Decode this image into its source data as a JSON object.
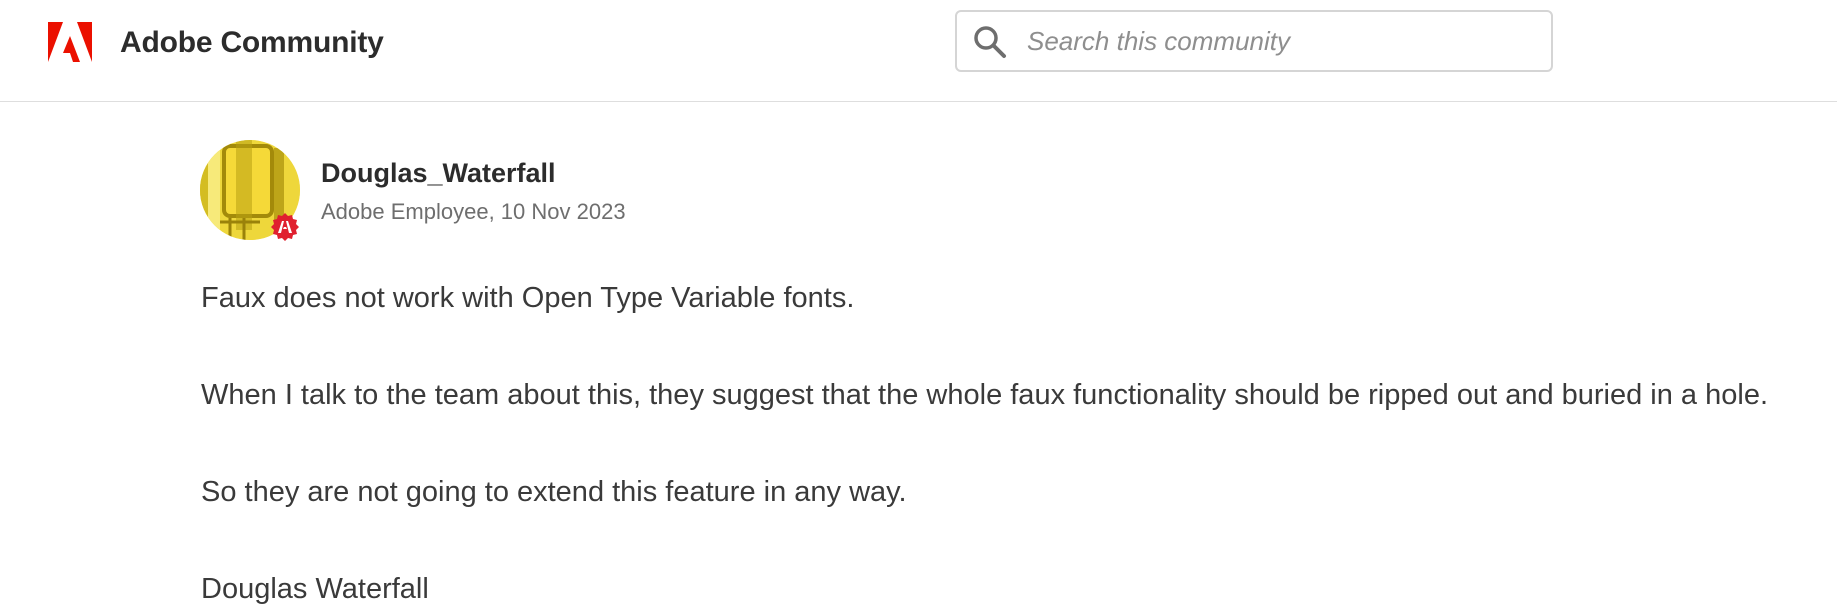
{
  "header": {
    "brand": "Adobe Community",
    "logo_icon": "adobe-logo-icon",
    "brand_color": "#eb1000",
    "search": {
      "placeholder": "Search this community",
      "value": ""
    }
  },
  "post": {
    "author": {
      "name": "Douglas_Waterfall",
      "role": "Adobe Employee",
      "date": "10 Nov 2023",
      "badge_icon": "adobe-employee-badge-icon"
    },
    "paragraphs": [
      "Faux does not work with Open Type Variable fonts.",
      "When I talk to the team about this, they suggest that the whole faux functionality should be ripped out and buried in a hole.",
      "So they are not going to extend this feature in any way.",
      "Douglas Waterfall"
    ]
  }
}
